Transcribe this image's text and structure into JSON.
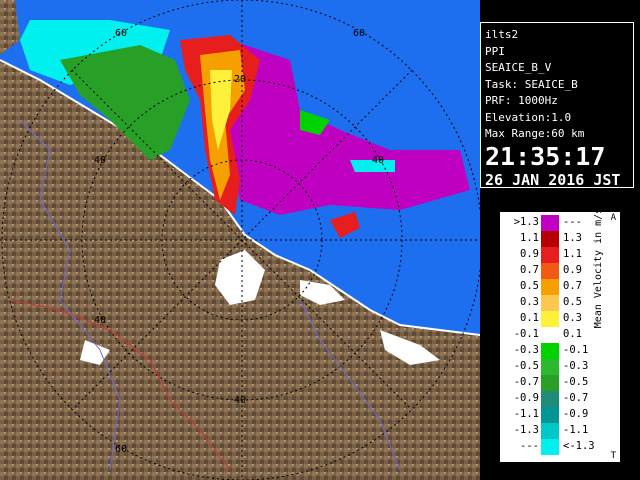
{
  "radar": {
    "site": "ilts2",
    "scan_type": "PPI",
    "product": "SEAICE_B_V",
    "task": "Task: SEAICE_B",
    "prf": "PRF: 1000Hz",
    "elevation": "Elevation:1.0",
    "max_range": "Max Range:60 km",
    "time": "21:35:17",
    "date": "26 JAN 2016 JST"
  },
  "range_ring_labels": [
    "20",
    "40",
    "60"
  ],
  "map_colors": {
    "sea": "#1e6ef0",
    "land": "#7a6046",
    "land_light": "#a08562",
    "coastline": "#ffffff",
    "rivers": "#6a6ad8",
    "boundaries": "#d0343c",
    "rings": "#000000"
  },
  "legend": {
    "title": "Mean Velocity in m/s",
    "cap_top": "A",
    "cap_bottom": "T",
    "rows": [
      {
        "lo": ">1.3",
        "hi": "---",
        "color": "#c000c0"
      },
      {
        "lo": "1.1",
        "hi": "1.3",
        "color": "#b40000"
      },
      {
        "lo": "0.9",
        "hi": "1.1",
        "color": "#e61e1e"
      },
      {
        "lo": "0.7",
        "hi": "0.9",
        "color": "#f05a14"
      },
      {
        "lo": "0.5",
        "hi": "0.7",
        "color": "#f5a000"
      },
      {
        "lo": "0.3",
        "hi": "0.5",
        "color": "#fac850"
      },
      {
        "lo": "0.1",
        "hi": "0.3",
        "color": "#fff03c"
      },
      {
        "lo": "-0.1",
        "hi": "0.1",
        "color": "#ffffff"
      },
      {
        "lo": "-0.3",
        "hi": "-0.1",
        "color": "#00d200"
      },
      {
        "lo": "-0.5",
        "hi": "-0.3",
        "color": "#2db92d"
      },
      {
        "lo": "-0.7",
        "hi": "-0.5",
        "color": "#28a028"
      },
      {
        "lo": "-0.9",
        "hi": "-0.7",
        "color": "#1e8c78"
      },
      {
        "lo": "-1.1",
        "hi": "-0.9",
        "color": "#009696"
      },
      {
        "lo": "-1.3",
        "hi": "-1.1",
        "color": "#00c8c8"
      },
      {
        "lo": "---",
        "hi": "<-1.3",
        "color": "#00f0f0"
      }
    ]
  }
}
